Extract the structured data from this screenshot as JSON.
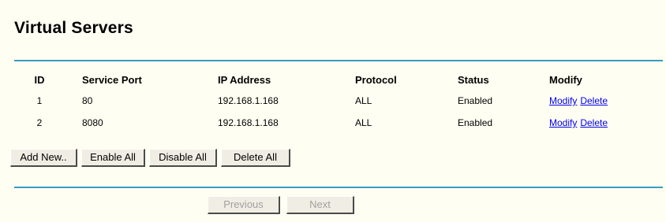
{
  "page": {
    "title": "Virtual Servers"
  },
  "table": {
    "headers": {
      "id": "ID",
      "service_port": "Service Port",
      "ip_address": "IP Address",
      "protocol": "Protocol",
      "status": "Status",
      "modify": "Modify"
    },
    "rows": [
      {
        "id": "1",
        "service_port": "80",
        "ip_address": "192.168.1.168",
        "protocol": "ALL",
        "status": "Enabled",
        "modify_label": "Modify",
        "delete_label": "Delete"
      },
      {
        "id": "2",
        "service_port": "8080",
        "ip_address": "192.168.1.168",
        "protocol": "ALL",
        "status": "Enabled",
        "modify_label": "Modify",
        "delete_label": "Delete"
      }
    ]
  },
  "actions": {
    "add_new": "Add New..",
    "enable_all": "Enable All",
    "disable_all": "Disable All",
    "delete_all": "Delete All"
  },
  "pager": {
    "previous": "Previous",
    "next": "Next",
    "previous_enabled": false,
    "next_enabled": false
  },
  "colors": {
    "background": "#fffef2",
    "rule": "#3a9ac4",
    "link": "#0000ee",
    "disabled_text": "#a0a0a0"
  }
}
